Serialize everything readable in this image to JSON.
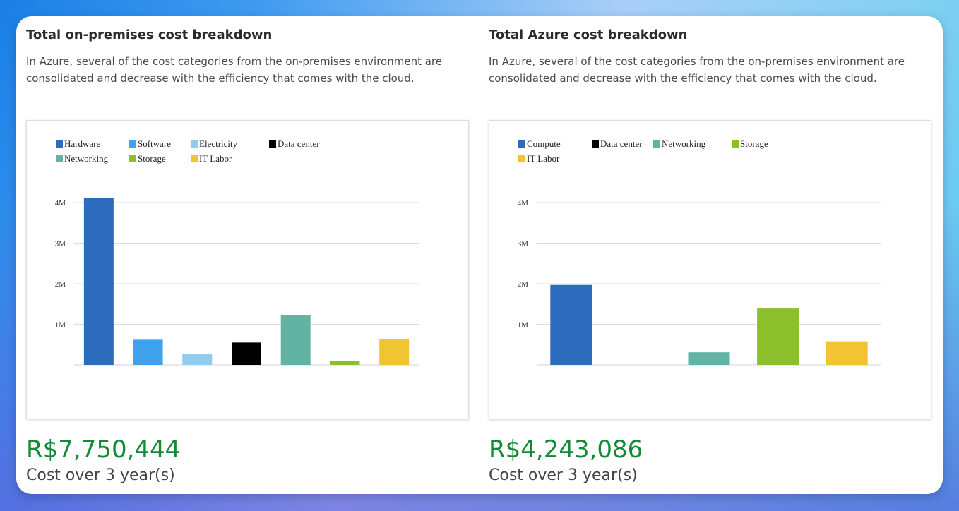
{
  "panels": [
    {
      "title": "Total on-premises cost breakdown",
      "description": "In Azure, several of the cost categories from the on-premises environment are consolidated and decrease with the efficiency that comes with the cloud.",
      "total": "R$7,750,444",
      "total_caption": "Cost over 3 year(s)"
    },
    {
      "title": "Total Azure cost breakdown",
      "description": "In Azure, several of the cost categories from the on-premises environment are consolidated and decrease with the efficiency that comes with the cloud.",
      "total": "R$4,243,086",
      "total_caption": "Cost over 3 year(s)"
    }
  ],
  "chart_data": [
    {
      "type": "bar",
      "title": "",
      "xlabel": "",
      "ylabel": "",
      "ylim": [
        0,
        4000000
      ],
      "yticks": [
        1000000,
        2000000,
        3000000,
        4000000
      ],
      "ytick_labels": [
        "1M",
        "2M",
        "3M",
        "4M"
      ],
      "grid": true,
      "legend_position": "top-left",
      "categories": [
        "Hardware",
        "Software",
        "Electricity",
        "Data center",
        "Networking",
        "Storage",
        "IT Labor"
      ],
      "values": [
        4120000,
        620000,
        260000,
        550000,
        1230000,
        100000,
        640000
      ],
      "colors": [
        "#2d6bbd",
        "#3ea3ec",
        "#93cbec",
        "#000000",
        "#62b3a4",
        "#8bbf2c",
        "#f1c531"
      ]
    },
    {
      "type": "bar",
      "title": "",
      "xlabel": "",
      "ylabel": "",
      "ylim": [
        0,
        4000000
      ],
      "yticks": [
        1000000,
        2000000,
        3000000,
        4000000
      ],
      "ytick_labels": [
        "1M",
        "2M",
        "3M",
        "4M"
      ],
      "grid": true,
      "legend_position": "top-left",
      "categories": [
        "Compute",
        "Data center",
        "Networking",
        "Storage",
        "IT Labor"
      ],
      "values": [
        1970000,
        0,
        310000,
        1390000,
        580000
      ],
      "colors": [
        "#2d6bbd",
        "#000000",
        "#62b3a4",
        "#8bbf2c",
        "#f1c531"
      ]
    }
  ]
}
